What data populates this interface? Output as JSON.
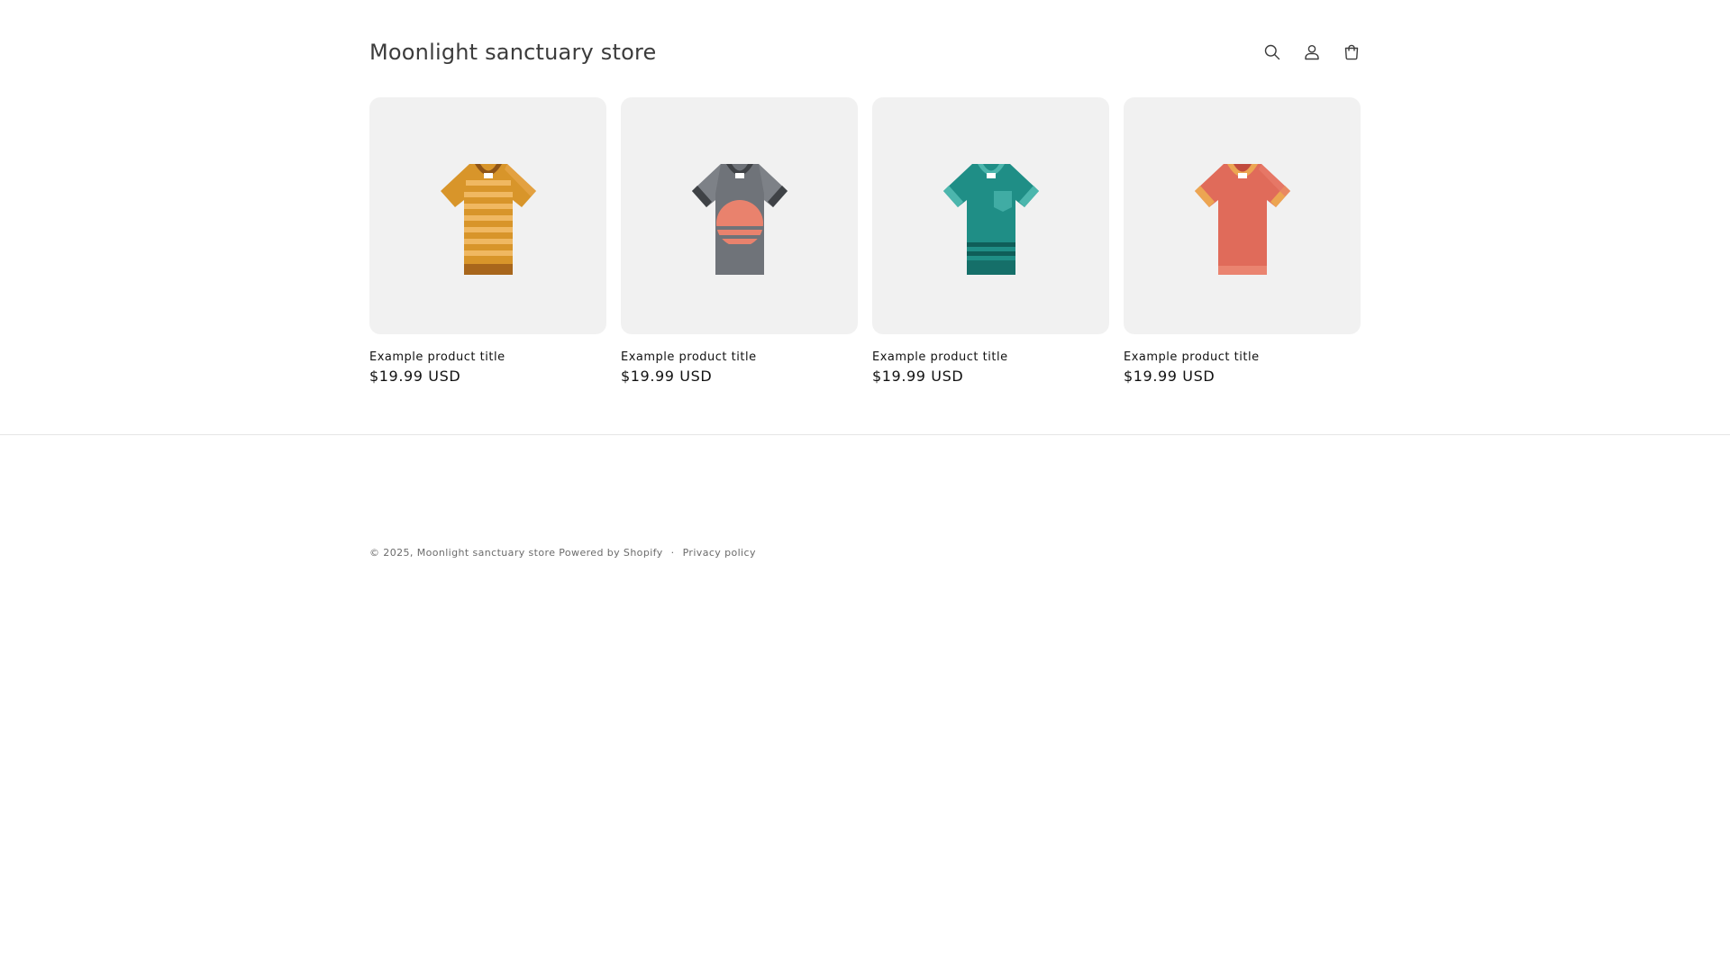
{
  "header": {
    "store_name": "Moonlight sanctuary store",
    "icons": [
      "search-icon",
      "account-icon",
      "cart-icon"
    ]
  },
  "products": [
    {
      "title": "Example product title",
      "price": "$19.99 USD",
      "image": "orange-striped-tshirt"
    },
    {
      "title": "Example product title",
      "price": "$19.99 USD",
      "image": "gray-sunset-tshirt"
    },
    {
      "title": "Example product title",
      "price": "$19.99 USD",
      "image": "teal-pocket-tshirt"
    },
    {
      "title": "Example product title",
      "price": "$19.99 USD",
      "image": "coral-ringer-tshirt"
    }
  ],
  "footer": {
    "copyright": "© 2025,",
    "store_link": "Moonlight sanctuary store",
    "powered_by": "Powered by Shopify",
    "separator": "·",
    "privacy_policy": "Privacy policy"
  }
}
